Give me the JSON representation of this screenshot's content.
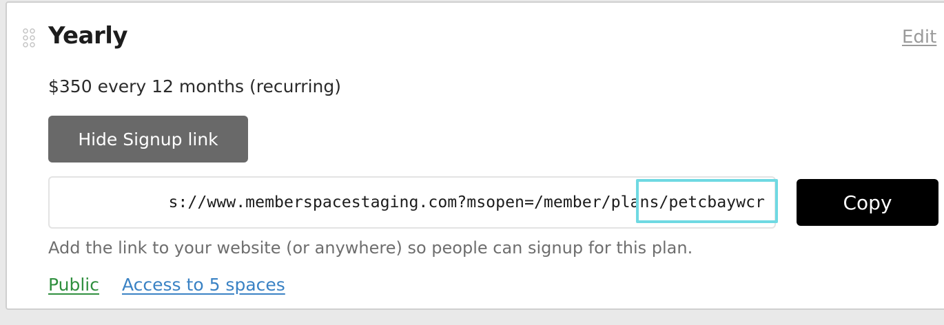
{
  "plan": {
    "title": "Yearly",
    "edit_label": "Edit",
    "price_text": "$350 every 12 months (recurring)",
    "hide_signup_label": "Hide Signup link",
    "signup_link_visible": "s://www.memberspacestaging.com?msopen=/member/plans/petcbaywcr",
    "copy_label": "Copy",
    "help_text": "Add the link to your website (or anywhere) so people can signup for this plan.",
    "visibility_label": "Public",
    "access_label": "Access to 5 spaces"
  },
  "icons": {
    "drag": "drag-handle-icon"
  },
  "colors": {
    "highlight": "#6fd9e2",
    "public": "#2f8f3e",
    "access": "#3a82c4",
    "hide_button": "#696969",
    "copy_button": "#000000"
  }
}
